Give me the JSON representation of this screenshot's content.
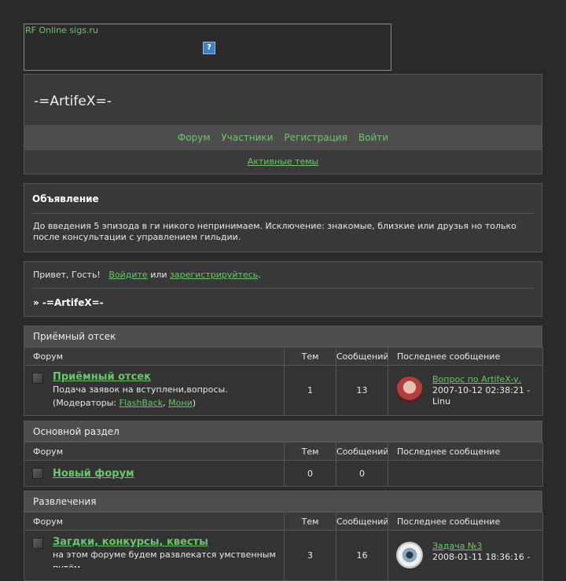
{
  "banner": {
    "link": "RF Online sigs.ru",
    "image_glyph": "?"
  },
  "header": {
    "site_title": "-=ArtifeX=-",
    "nav": [
      "Форум",
      "Участники",
      "Регистрация",
      "Войти"
    ],
    "active_topics": "Активные темы"
  },
  "announcement": {
    "title": "Объявление",
    "text": "До введения 5 эпизода в ги никого непринимаем. Исключение: знакомые, близкие или друзья но только после консультации с управлением гильдии."
  },
  "welcome": {
    "greeting": "Привет, Гость!",
    "login": "Войдите",
    "or": "или",
    "register": "зарегистрируйтесь",
    "end": ".",
    "crumb": "» -=ArtifeX=-"
  },
  "columns": {
    "forum": "Форум",
    "topics": "Тем",
    "posts": "Сообщений",
    "last": "Последнее сообщение"
  },
  "categories": [
    {
      "title": "Приёмный отсек",
      "forums": [
        {
          "name": "Приёмный отсек",
          "desc": "Подача заявок на вступлени,вопросы.",
          "mods_prefix": "(Модераторы: ",
          "mod1": "FlashBack",
          "sep": ", ",
          "mod2": "Мони",
          "mods_suffix": ")",
          "topics": "1",
          "posts": "13",
          "last_title": "Вопрос по ArtifeX-у.",
          "last_date": "2007-10-12 02:38:21 -",
          "last_user": "Linu",
          "avatar_color": "#b04040"
        }
      ]
    },
    {
      "title": "Основной раздел",
      "forums": [
        {
          "name": "Новый форум",
          "topics": "0",
          "posts": "0"
        }
      ]
    },
    {
      "title": "Развлечения",
      "forums": [
        {
          "name": "Загдки, конкурсы, квесты",
          "desc": "на этом форуме будем развлекатся умственным путём",
          "topics": "3",
          "posts": "16",
          "last_title": "Задача №3",
          "last_date": "2008-01-11 18:36:16 -",
          "avatar_color": "#8aa8c0"
        }
      ]
    }
  ]
}
